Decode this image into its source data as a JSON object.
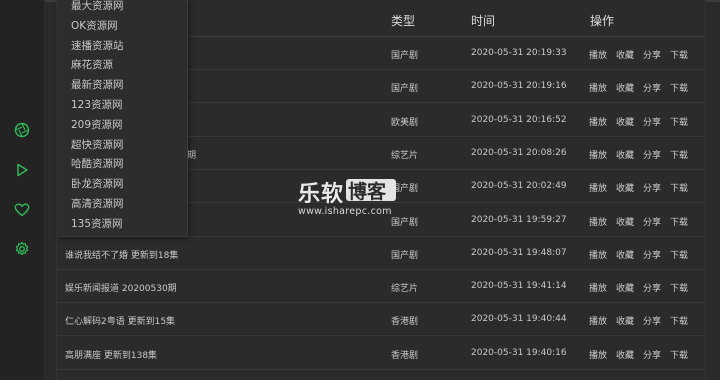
{
  "table": {
    "headers": {
      "type": "类型",
      "time": "时间",
      "actions": "操作"
    },
    "rows": [
      {
        "title": "",
        "type": "国产剧",
        "time": "2020-05-31 20:19:33"
      },
      {
        "title": "",
        "type": "国产剧",
        "time": "2020-05-31 20:19:16"
      },
      {
        "title": "",
        "type": "欧美剧",
        "time": "2020-05-31 20:16:52"
      },
      {
        "title": "期",
        "type": "综艺片",
        "time": "2020-05-31 20:08:26"
      },
      {
        "title": "",
        "type": "国产剧",
        "time": "2020-05-31 20:02:49"
      },
      {
        "title": "",
        "type": "国产剧",
        "time": "2020-05-31 19:59:27"
      },
      {
        "title": "谁说我结不了婚 更新到18集",
        "type": "国产剧",
        "time": "2020-05-31 19:48:07"
      },
      {
        "title": "娱乐新闻报道 20200530期",
        "type": "综艺片",
        "time": "2020-05-31 19:41:14"
      },
      {
        "title": "仁心解码2粤语 更新到15集",
        "type": "香港剧",
        "time": "2020-05-31 19:40:44"
      },
      {
        "title": "高朋满座 更新到138集",
        "type": "香港剧",
        "time": "2020-05-31 19:40:16"
      }
    ],
    "action_labels": {
      "play": "播放",
      "favorite": "收藏",
      "share": "分享",
      "download": "下载"
    }
  },
  "source_menu": {
    "items": [
      "最大资源网",
      "OK资源网",
      "速播资源站",
      "麻花资源",
      "最新资源网",
      "123资源网",
      "209资源网",
      "超快资源网",
      "哈酷资源网",
      "卧龙资源网",
      "高清资源网",
      "135资源网"
    ]
  },
  "sidebar": {
    "icons": [
      "aperture-icon",
      "play-icon",
      "heart-icon",
      "settings-icon"
    ],
    "accent_color": "#2fbf5a"
  },
  "watermark": {
    "brand": "乐软",
    "brand_box": "博客",
    "url": "www.isharepc.com"
  }
}
